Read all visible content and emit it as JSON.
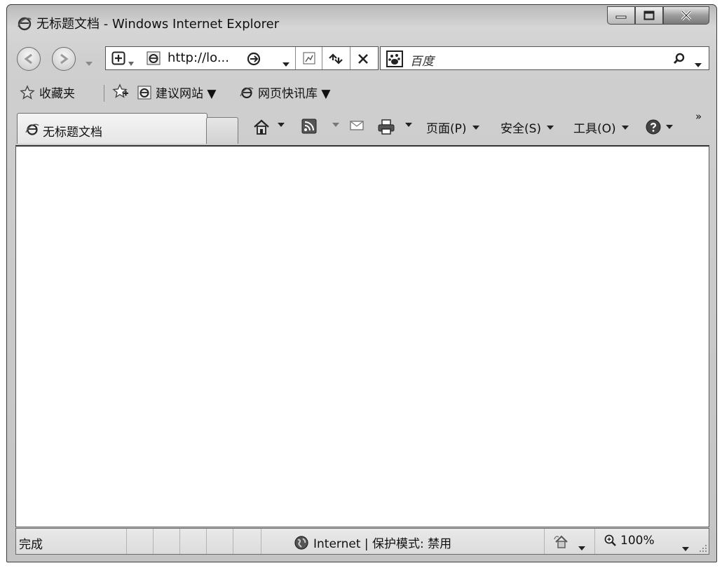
{
  "window": {
    "title": "无标题文档 - Windows Internet Explorer"
  },
  "navigation": {
    "address_url": "http://lo...",
    "search_placeholder": "百度"
  },
  "favorites_bar": {
    "favorites_label": "收藏夹",
    "items": [
      {
        "label": "建议网站 ▼"
      },
      {
        "label": "网页快讯库 ▼"
      }
    ]
  },
  "tabs": [
    {
      "label": "无标题文档",
      "active": true
    }
  ],
  "command_bar": {
    "page_label": "页面(P)",
    "safety_label": "安全(S)",
    "tools_label": "工具(O)",
    "overflow_label": "»"
  },
  "status_bar": {
    "status_text": "完成",
    "zone_text": "Internet | 保护模式: 禁用",
    "zoom_text": "100%"
  },
  "icons": {
    "browser": "ie-logo-icon",
    "back": "back-arrow-icon",
    "forward": "forward-arrow-icon",
    "refresh": "refresh-icon",
    "stop": "stop-icon",
    "search": "magnifier-icon",
    "home": "home-icon",
    "feeds": "rss-icon",
    "mail": "mail-icon",
    "print": "printer-icon",
    "help": "help-icon",
    "globe": "globe-icon",
    "zoom": "zoom-icon"
  }
}
